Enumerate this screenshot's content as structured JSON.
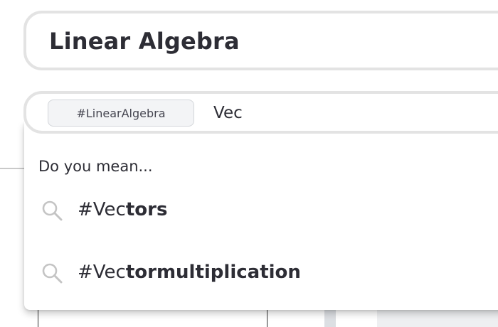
{
  "title_field": {
    "value": "Linear Algebra"
  },
  "tag_field": {
    "chip_label": "#LinearAlgebra",
    "query": "Vec"
  },
  "dropdown": {
    "hint": "Do you mean...",
    "suggestions": [
      {
        "prefix": "#Vec",
        "completion": "tors",
        "icon": "search-icon"
      },
      {
        "prefix": "#Vec",
        "completion": "tormultiplication",
        "icon": "search-icon"
      }
    ]
  },
  "colors": {
    "text": "#2d2d35",
    "field_border": "#e3e3e3",
    "chip_background": "#f3f4f6",
    "chip_border": "#d3d6da",
    "icon": "#c4c4c4"
  }
}
